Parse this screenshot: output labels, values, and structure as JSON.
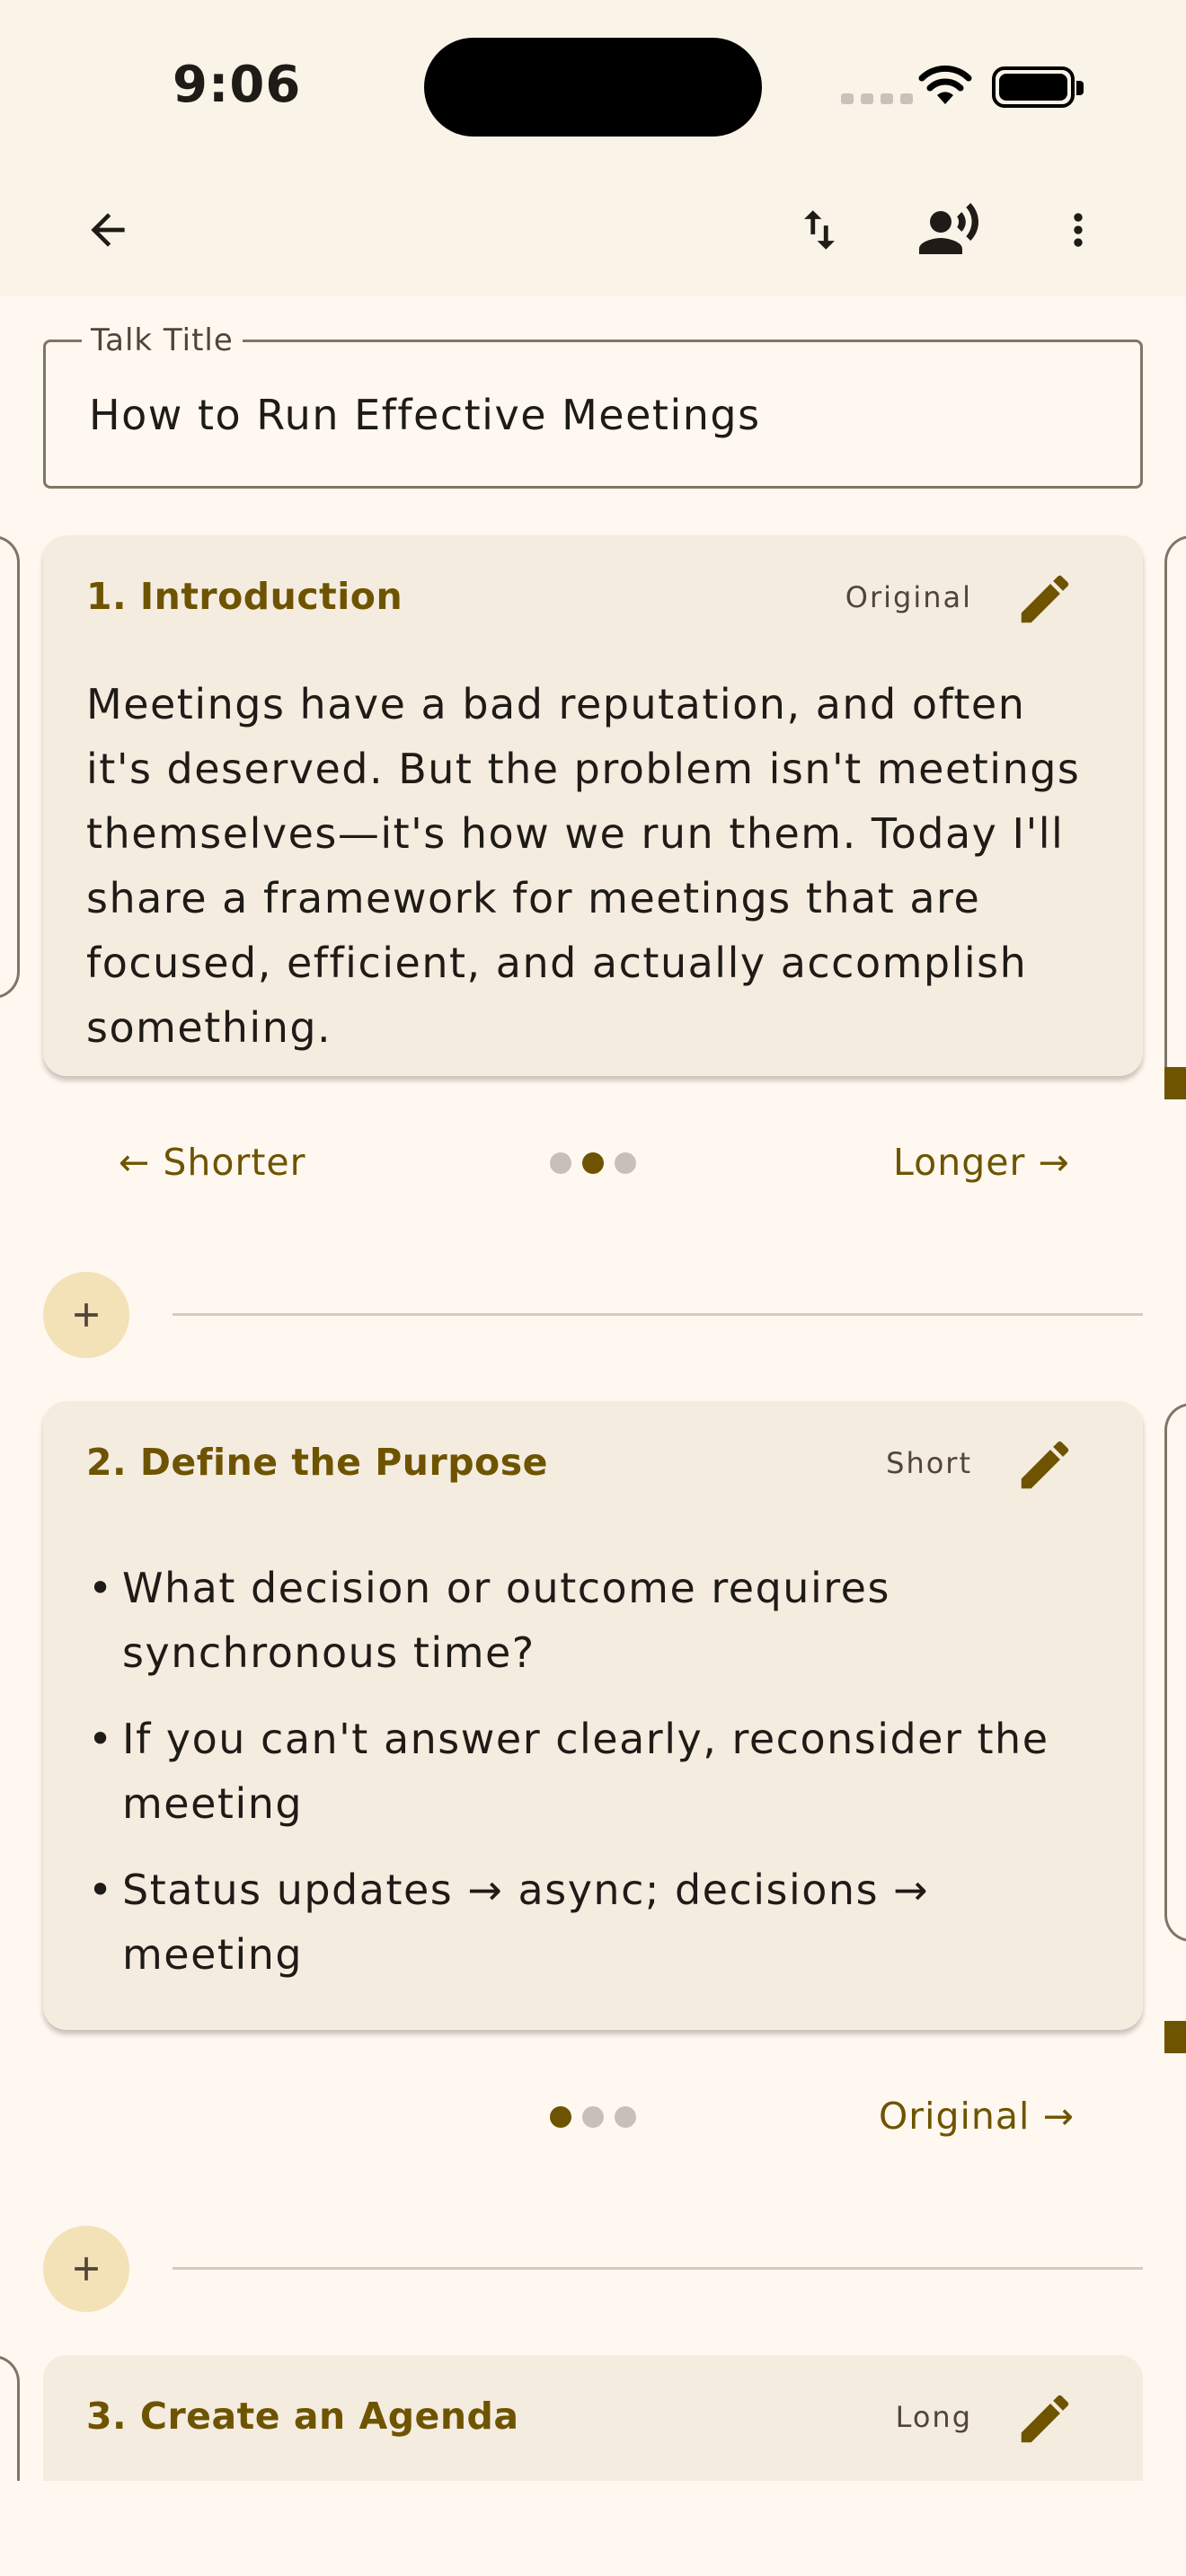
{
  "status_bar": {
    "time": "9:06"
  },
  "app_bar": {
    "back_icon": "arrow-back-icon",
    "actions": [
      {
        "name": "reorder",
        "icon": "swap-vert-icon"
      },
      {
        "name": "rehearse",
        "icon": "record-voice-icon"
      },
      {
        "name": "more",
        "icon": "more-vert-icon"
      }
    ]
  },
  "talk_title": {
    "label": "Talk Title",
    "value": "How to Run Effective Meetings"
  },
  "sections": [
    {
      "title": "1. Introduction",
      "version": "Original",
      "body": "Meetings have a bad reputation, and often it's deserved. But the problem isn't meetings themselves—it's how we run them. Today I'll share a framework for meetings that are focused, efficient, and actually accomplish something.",
      "pager": {
        "prev": "← Shorter",
        "next": "Longer →",
        "active_index": 1,
        "count": 3
      }
    },
    {
      "title": "2. Define the Purpose",
      "version": "Short",
      "bullets": [
        "What decision or outcome requires synchronous time?",
        "If you can't answer clearly, reconsider the meeting",
        "Status updates → async; decisions → meeting"
      ],
      "pager": {
        "prev": "",
        "next": "Original →",
        "active_index": 0,
        "count": 3
      }
    },
    {
      "title": "3. Create an Agenda",
      "version": "Long"
    }
  ],
  "colors": {
    "accent": "#6E5400",
    "surface": "#FFF8F0",
    "card": "#F5ECE0",
    "add_button": "#F3E2B8",
    "outline": "#7E7667"
  }
}
